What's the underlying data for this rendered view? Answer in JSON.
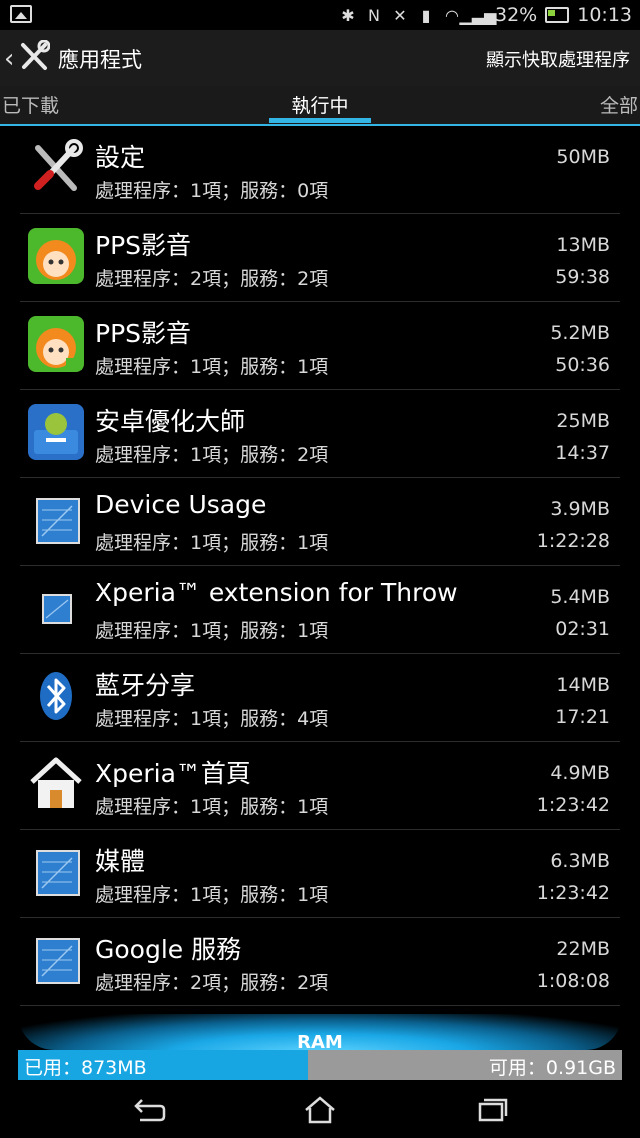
{
  "status_bar": {
    "battery": "32%",
    "time": "10:13"
  },
  "action_bar": {
    "title": "應用程式",
    "action": "顯示快取處理程序"
  },
  "tabs": {
    "left": "已下載",
    "center": "執行中",
    "right": "全部"
  },
  "apps": [
    {
      "name": "設定",
      "detail": "處理程序：1項；服務：0項",
      "size": "50MB",
      "time": "",
      "icon": "tools-icon"
    },
    {
      "name": "PPS影音",
      "detail": "處理程序：2項；服務：2項",
      "size": "13MB",
      "time": "59:38",
      "icon": "pps-icon"
    },
    {
      "name": "PPS影音",
      "detail": "處理程序：1項；服務：1項",
      "size": "5.2MB",
      "time": "50:36",
      "icon": "pps-hd-icon"
    },
    {
      "name": "安卓優化大師",
      "detail": "處理程序：1項；服務：2項",
      "size": "25MB",
      "time": "14:37",
      "icon": "android-toolbox-icon"
    },
    {
      "name": "Device Usage",
      "detail": "處理程序：1項；服務：1項",
      "size": "3.9MB",
      "time": "1:22:28",
      "icon": "blueprint-icon"
    },
    {
      "name": "Xperia™ extension for Throw",
      "detail": "處理程序：1項；服務：1項",
      "size": "5.4MB",
      "time": "02:31",
      "icon": "blueprint-small-icon"
    },
    {
      "name": "藍牙分享",
      "detail": "處理程序：1項；服務：4項",
      "size": "14MB",
      "time": "17:21",
      "icon": "bluetooth-icon"
    },
    {
      "name": "Xperia™首頁",
      "detail": "處理程序：1項；服務：1項",
      "size": "4.9MB",
      "time": "1:23:42",
      "icon": "home-icon"
    },
    {
      "name": "媒體",
      "detail": "處理程序：1項；服務：1項",
      "size": "6.3MB",
      "time": "1:23:42",
      "icon": "blueprint-icon"
    },
    {
      "name": "Google 服務",
      "detail": "處理程序：2項；服務：2項",
      "size": "22MB",
      "time": "1:08:08",
      "icon": "blueprint-icon"
    }
  ],
  "ram": {
    "label": "RAM",
    "used": "已用：873MB",
    "free": "可用：0.91GB",
    "used_fraction": 0.48
  },
  "colors": {
    "accent": "#33b5e5",
    "ram_used": "#18a6e2",
    "ram_free": "#9a9a9a"
  }
}
